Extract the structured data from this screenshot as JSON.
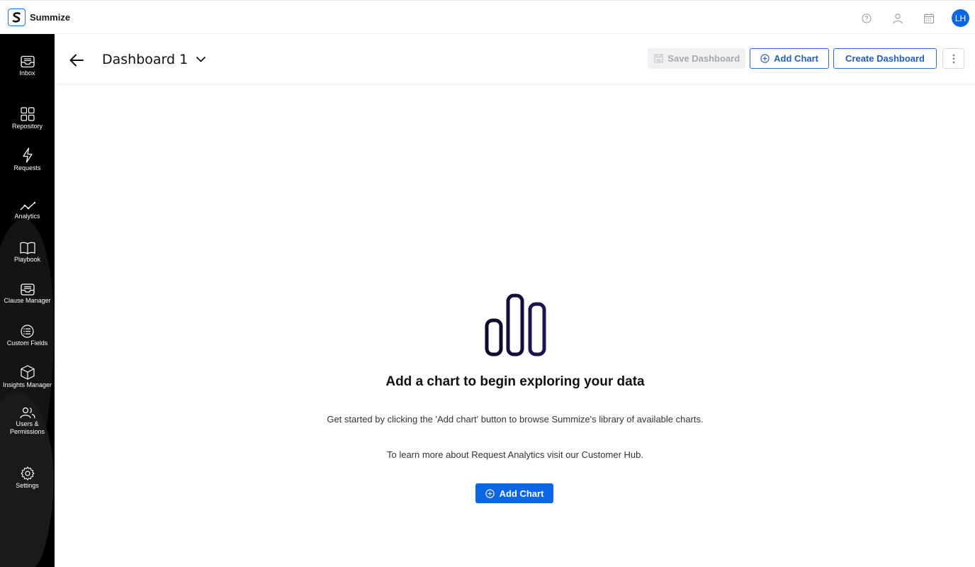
{
  "brand": {
    "name": "Summize"
  },
  "topbar": {
    "avatar_initials": "LH"
  },
  "sidebar": {
    "items": [
      {
        "label": "Inbox",
        "icon": "inbox-icon"
      },
      {
        "label": "Repository",
        "icon": "grid-icon"
      },
      {
        "label": "Requests",
        "icon": "lightning-icon"
      },
      {
        "label": "Analytics",
        "icon": "trend-line-icon"
      },
      {
        "label": "Playbook",
        "icon": "book-icon"
      },
      {
        "label": "Clause Manager",
        "icon": "tray-icon"
      },
      {
        "label": "Custom Fields",
        "icon": "list-circle-icon"
      },
      {
        "label": "Insights Manager",
        "icon": "cube-icon"
      },
      {
        "label": "Users & Permissions",
        "icon": "users-icon"
      },
      {
        "label": "Settings",
        "icon": "gear-icon"
      }
    ]
  },
  "header": {
    "title": "Dashboard 1",
    "save_label": "Save Dashboard",
    "add_chart_label": "Add Chart",
    "create_label": "Create Dashboard"
  },
  "empty_state": {
    "title": "Add a chart to begin exploring your data",
    "description": "Get started by clicking the 'Add chart' button to browse Summize's library of available charts.",
    "hub_text": "To learn more about Request Analytics visit our Customer Hub.",
    "cta_label": "Add Chart"
  },
  "colors": {
    "accent": "#0b66e4",
    "sidebar": "#000000",
    "illustration": "#1a1446"
  }
}
